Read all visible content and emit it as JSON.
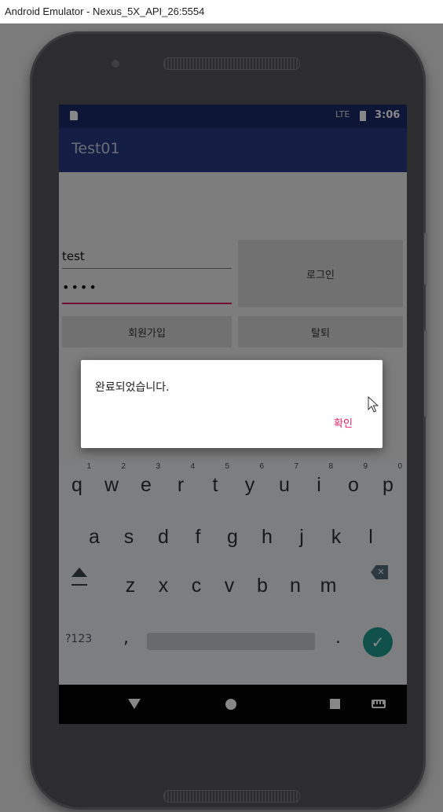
{
  "window": {
    "title": "Android Emulator - Nexus_5X_API_26:5554"
  },
  "statusbar": {
    "time": "3:06",
    "signal_label": "LTE"
  },
  "appbar": {
    "title": "Test01"
  },
  "form": {
    "id_value": "test",
    "password_value": "••••",
    "login_label": "로그인",
    "signup_label": "회원가입",
    "withdraw_label": "탈퇴"
  },
  "dialog": {
    "message": "완료되었습니다.",
    "ok_label": "확인"
  },
  "keyboard": {
    "row1": [
      "q",
      "w",
      "e",
      "r",
      "t",
      "y",
      "u",
      "i",
      "o",
      "p"
    ],
    "row1_hints": [
      "1",
      "2",
      "3",
      "4",
      "5",
      "6",
      "7",
      "8",
      "9",
      "0"
    ],
    "row2": [
      "a",
      "s",
      "d",
      "f",
      "g",
      "h",
      "j",
      "k",
      "l"
    ],
    "row3": [
      "z",
      "x",
      "c",
      "v",
      "b",
      "n",
      "m"
    ],
    "symbols_label": "?123",
    "comma": ",",
    "period": "."
  },
  "colors": {
    "appbar": "#26377f",
    "statusbar": "#1c2a6a",
    "accent": "#e91e63",
    "enter_key": "#1e9a8c"
  },
  "icons": [
    "sd-card-icon",
    "signal-icon",
    "battery-icon",
    "shift-icon",
    "backspace-icon",
    "check-icon",
    "back-icon",
    "home-icon",
    "recents-icon",
    "keyboard-icon",
    "mouse-cursor-icon"
  ]
}
